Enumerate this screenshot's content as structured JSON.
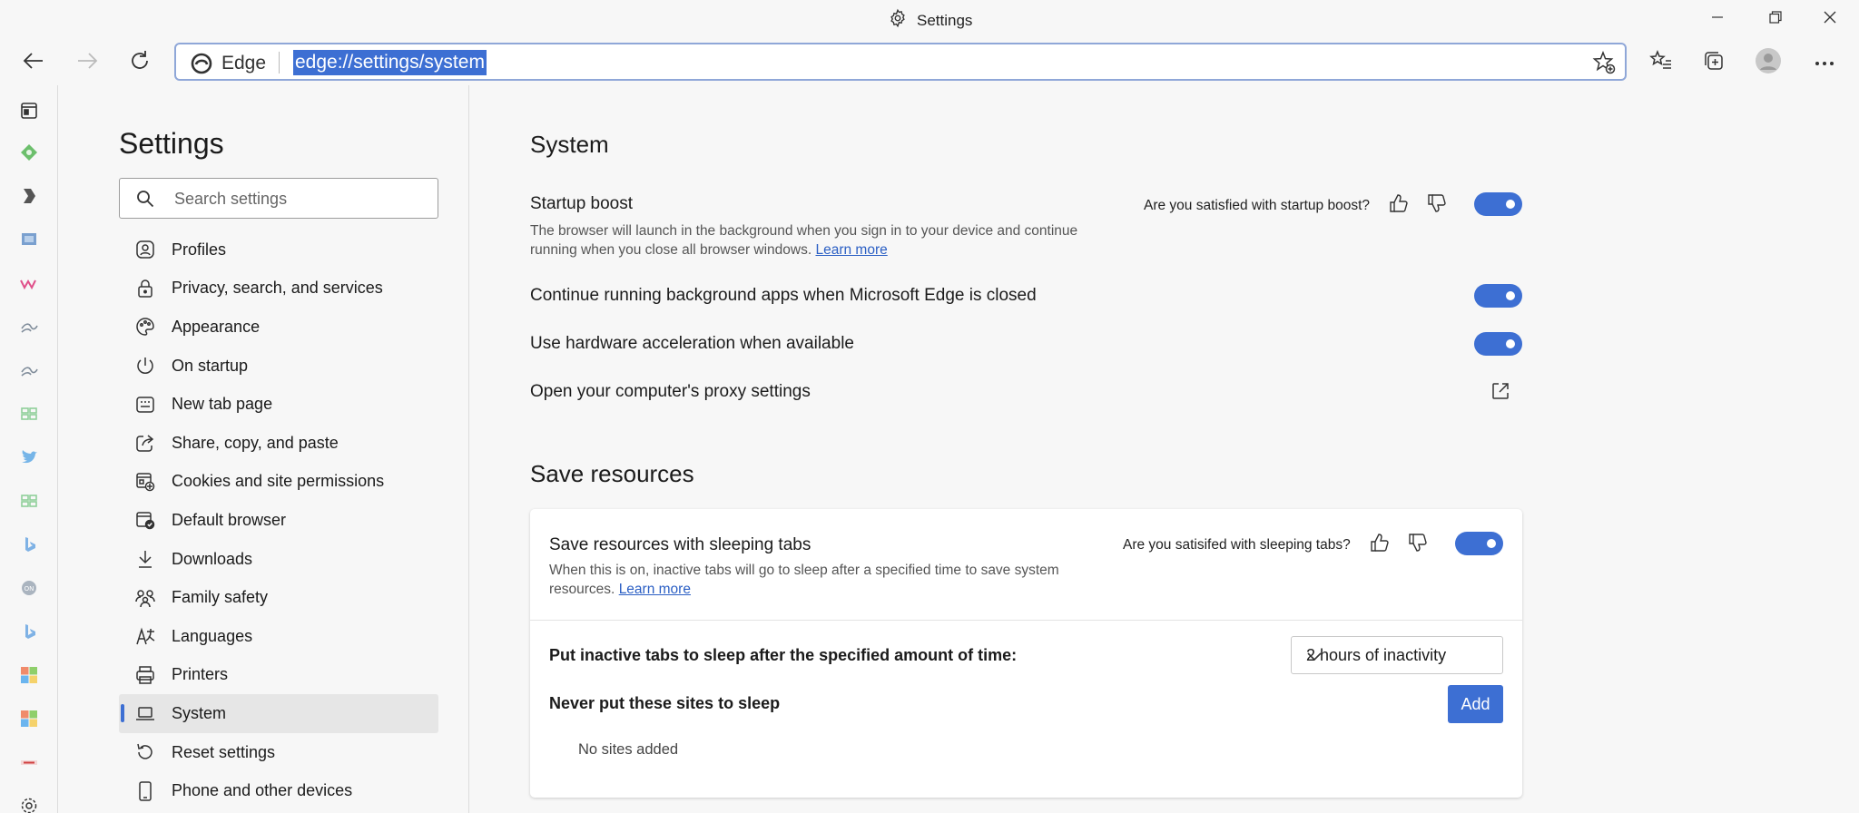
{
  "window": {
    "title": "Settings",
    "minimize_icon": "minimize-icon",
    "restore_icon": "restore-icon",
    "close_icon": "close-icon"
  },
  "toolbar": {
    "browser_label": "Edge",
    "url": "edge://settings/system",
    "back_icon": "back-arrow-icon",
    "forward_icon": "forward-arrow-icon",
    "refresh_icon": "refresh-icon",
    "favorites_add_icon": "star-plus-icon",
    "favorites_icon": "favorites-list-icon",
    "collections_icon": "collections-icon",
    "profile_icon": "profile-avatar-icon",
    "more_icon": "ellipsis-icon"
  },
  "colors": {
    "accent": "#3d6fd3",
    "link": "#2b5fc4",
    "background": "#f7f7f7"
  },
  "sidebar": {
    "title": "Settings",
    "search_placeholder": "Search settings",
    "items": [
      {
        "label": "Profiles",
        "icon": "profile-icon"
      },
      {
        "label": "Privacy, search, and services",
        "icon": "lock-icon"
      },
      {
        "label": "Appearance",
        "icon": "palette-icon"
      },
      {
        "label": "On startup",
        "icon": "power-icon"
      },
      {
        "label": "New tab page",
        "icon": "new-tab-icon"
      },
      {
        "label": "Share, copy, and paste",
        "icon": "share-icon"
      },
      {
        "label": "Cookies and site permissions",
        "icon": "cookies-icon"
      },
      {
        "label": "Default browser",
        "icon": "default-browser-icon"
      },
      {
        "label": "Downloads",
        "icon": "download-icon"
      },
      {
        "label": "Family safety",
        "icon": "family-icon"
      },
      {
        "label": "Languages",
        "icon": "languages-icon"
      },
      {
        "label": "Printers",
        "icon": "printer-icon"
      },
      {
        "label": "System",
        "icon": "laptop-icon",
        "active": true
      },
      {
        "label": "Reset settings",
        "icon": "reset-icon"
      },
      {
        "label": "Phone and other devices",
        "icon": "phone-icon"
      }
    ]
  },
  "main": {
    "system_heading": "System",
    "startup_boost": {
      "title": "Startup boost",
      "description": "The browser will launch in the background when you sign in to your device and continue running when you close all browser windows.",
      "learn_more": "Learn more",
      "feedback_question": "Are you satisfied with startup boost?",
      "enabled": true
    },
    "background_apps": {
      "title": "Continue running background apps when Microsoft Edge is closed",
      "enabled": true
    },
    "hardware_acceleration": {
      "title": "Use hardware acceleration when available",
      "enabled": true
    },
    "proxy": {
      "title": "Open your computer's proxy settings",
      "icon": "external-link-icon"
    },
    "save_heading": "Save resources",
    "sleeping_tabs": {
      "title": "Save resources with sleeping tabs",
      "description": "When this is on, inactive tabs will go to sleep after a specified time to save system resources.",
      "learn_more": "Learn more",
      "feedback_question": "Are you satisifed with sleeping tabs?",
      "enabled": true
    },
    "sleep_timer": {
      "label": "Put inactive tabs to sleep after the specified amount of time:",
      "selected": "2 hours of inactivity"
    },
    "never_sleep": {
      "label": "Never put these sites to sleep",
      "add_button": "Add",
      "empty_text": "No sites added"
    }
  }
}
